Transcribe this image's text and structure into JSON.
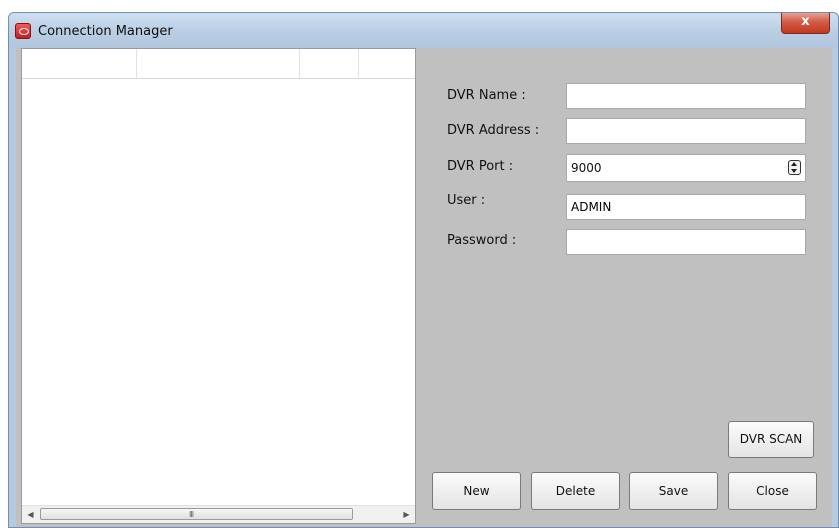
{
  "window": {
    "title": "Connection Manager",
    "close_label": "x"
  },
  "list": {
    "scroll_grip": "III"
  },
  "form": {
    "dvr_name": {
      "label": "DVR Name :",
      "value": ""
    },
    "dvr_address": {
      "label": "DVR Address :",
      "value": ""
    },
    "dvr_port": {
      "label": "DVR Port :",
      "value": "9000"
    },
    "user": {
      "label": "User :",
      "value": "ADMIN"
    },
    "password": {
      "label": "Password :",
      "value": ""
    }
  },
  "buttons": {
    "dvr_scan": "DVR SCAN",
    "new": "New",
    "delete": "Delete",
    "save": "Save",
    "close": "Close"
  },
  "icons": {
    "app": "app-logo-icon",
    "close": "close-icon",
    "scroll_left": "arrow-left-icon",
    "scroll_right": "arrow-right-icon",
    "spin": "spin-updown-icon"
  },
  "colors": {
    "client_bg": "#c0c0c0",
    "titlebar": "#b9cde3",
    "close_button": "#c2391f"
  }
}
